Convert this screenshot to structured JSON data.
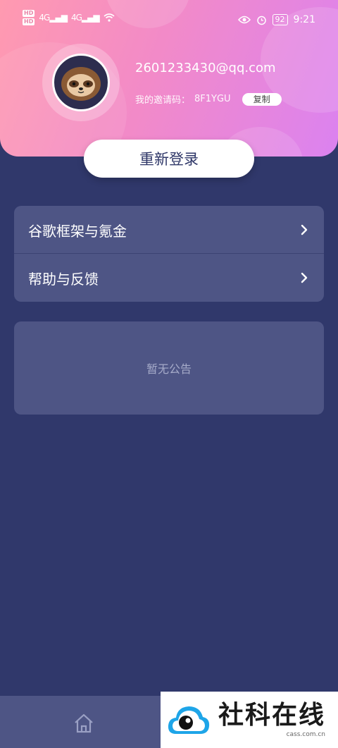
{
  "status_bar": {
    "hd_badges": [
      "HD",
      "HD"
    ],
    "signal_labels": [
      "4G",
      "4G"
    ],
    "battery": "92",
    "time": "9:21"
  },
  "profile": {
    "email": "2601233430@qq.com",
    "invite_label": "我的邀请码：",
    "invite_code": "8F1YGU",
    "copy_label": "复制"
  },
  "relogin_label": "重新登录",
  "menu": {
    "items": [
      {
        "label": "谷歌框架与氪金",
        "icon": "chevron-right-icon"
      },
      {
        "label": "帮助与反馈",
        "icon": "chevron-right-icon"
      }
    ]
  },
  "notice": {
    "text": "暂无公告"
  },
  "tab_bar": {
    "home_icon": "home-icon"
  },
  "watermark": {
    "title": "社科在线",
    "subtitle": "cass.com.cn"
  },
  "colors": {
    "page_bg": "#30386b",
    "card_bg": "#4e5585",
    "header_gradient_start": "#ff9ab0",
    "header_gradient_end": "#db82f0",
    "accent_text": "#2f3768"
  }
}
